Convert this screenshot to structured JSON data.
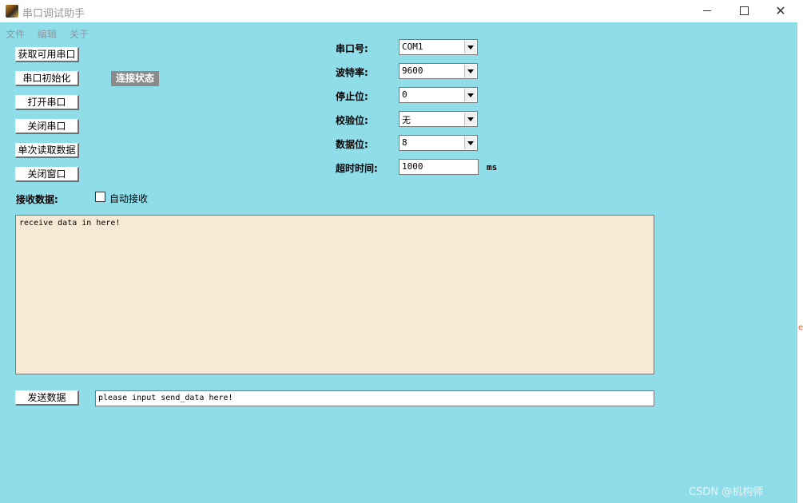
{
  "window": {
    "title": "串口调试助手"
  },
  "menu": {
    "items": [
      "文件",
      "编辑",
      "关于"
    ]
  },
  "buttons": {
    "get_ports": "获取可用串口",
    "init_port": "串口初始化",
    "open_port": "打开串口",
    "close_port": "关闭串口",
    "read_once": "单次读取数据",
    "close_window": "关闭窗口",
    "send": "发送数据"
  },
  "status": {
    "connection": "连接状态"
  },
  "settings": {
    "port": {
      "label": "串口号:",
      "value": "COM1"
    },
    "baud": {
      "label": "波特率:",
      "value": "9600"
    },
    "stop_bits": {
      "label": "停止位:",
      "value": "0"
    },
    "parity": {
      "label": "校验位:",
      "value": "无"
    },
    "data_bits": {
      "label": "数据位:",
      "value": "8"
    },
    "timeout": {
      "label": "超时时间:",
      "value": "1000",
      "unit": "ms"
    }
  },
  "receive": {
    "label": "接收数据:",
    "auto_receive_label": "自动接收",
    "auto_receive_checked": false,
    "content": "receive data in here!"
  },
  "send": {
    "content": "please input send_data here!"
  },
  "watermark": "CSDN @机构师",
  "colors": {
    "background": "#8fdde9",
    "receive_area": "#f8e9d7",
    "status_label": "#8b8b8b"
  }
}
